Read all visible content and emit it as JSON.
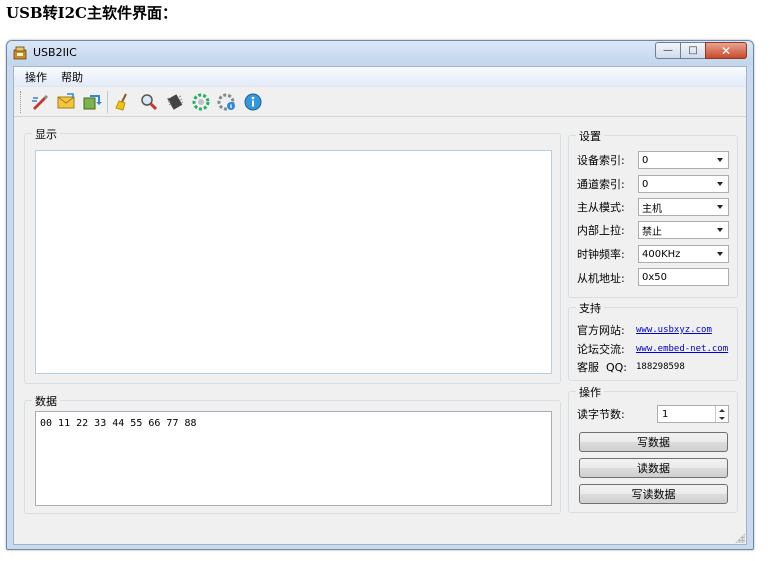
{
  "doc_heading": "USB转I2C主软件界面：",
  "window": {
    "title": "USB2IIC",
    "minimize": "—",
    "maximize": "□",
    "close": "✕"
  },
  "menu": {
    "items": [
      "操作",
      "帮助"
    ]
  },
  "toolbar": {
    "icons": [
      "write-icon",
      "mail-icon",
      "transfer-icon",
      "broom-icon",
      "search-icon",
      "chip-icon",
      "refresh-gear-icon",
      "settings-icon",
      "info-icon"
    ]
  },
  "display": {
    "title": "显示",
    "content": ""
  },
  "data_panel": {
    "title": "数据",
    "content": "00 11 22 33 44 55 66 77 88"
  },
  "settings": {
    "title": "设置",
    "device_index": {
      "label": "设备索引:",
      "value": "0"
    },
    "channel_index": {
      "label": "通道索引:",
      "value": "0"
    },
    "mode": {
      "label": "主从模式:",
      "value": "主机"
    },
    "pullup": {
      "label": "内部上拉:",
      "value": "禁止"
    },
    "clock": {
      "label": "时钟频率:",
      "value": "400KHz"
    },
    "slave_addr": {
      "label": "从机地址:",
      "value": "0x50"
    }
  },
  "support": {
    "title": "支持",
    "website": {
      "label": "官方网站:",
      "value": "www.usbxyz.com"
    },
    "forum": {
      "label": "论坛交流:",
      "value": "www.embed-net.com"
    },
    "qq": {
      "label": "客服  QQ:",
      "value": "188298598"
    }
  },
  "operation": {
    "title": "操作",
    "read_bytes": {
      "label": "读字节数:",
      "value": "1"
    },
    "write_button": "写数据",
    "read_button": "读数据",
    "write_read_button": "写读数据"
  }
}
